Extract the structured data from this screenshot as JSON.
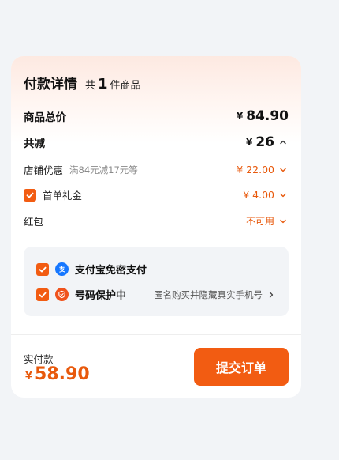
{
  "colors": {
    "accent": "#f25c12",
    "price_orange": "#e8590c",
    "alipay_blue": "#1677ff"
  },
  "header": {
    "title": "付款详情",
    "count_prefix": "共",
    "count": "1",
    "count_suffix": "件商品"
  },
  "total": {
    "label": "商品总价",
    "currency": "¥",
    "amount": "84.90"
  },
  "discount": {
    "label": "共减",
    "currency": "¥",
    "amount": "26",
    "icon": "chevron-up-icon"
  },
  "store_discount": {
    "label": "店铺优惠",
    "detail": "满84元减17元等",
    "value": "¥ 22.00",
    "icon": "chevron-down-icon"
  },
  "first_gift": {
    "label": "首单礼金",
    "value": "¥ 4.00",
    "checked": true,
    "icon": "chevron-down-icon"
  },
  "red_packet": {
    "label": "红包",
    "value": "不可用",
    "icon": "chevron-down-icon"
  },
  "alipay": {
    "label": "支付宝免密支付",
    "icon": "alipay-icon",
    "checked": true
  },
  "number_protect": {
    "label": "号码保护中",
    "desc": "匿名购买并隐藏真实手机号",
    "icon": "shield-icon",
    "checked": true
  },
  "footer": {
    "actual_label": "实付款",
    "currency": "¥",
    "actual_amount": "58.90",
    "submit_label": "提交订单"
  }
}
